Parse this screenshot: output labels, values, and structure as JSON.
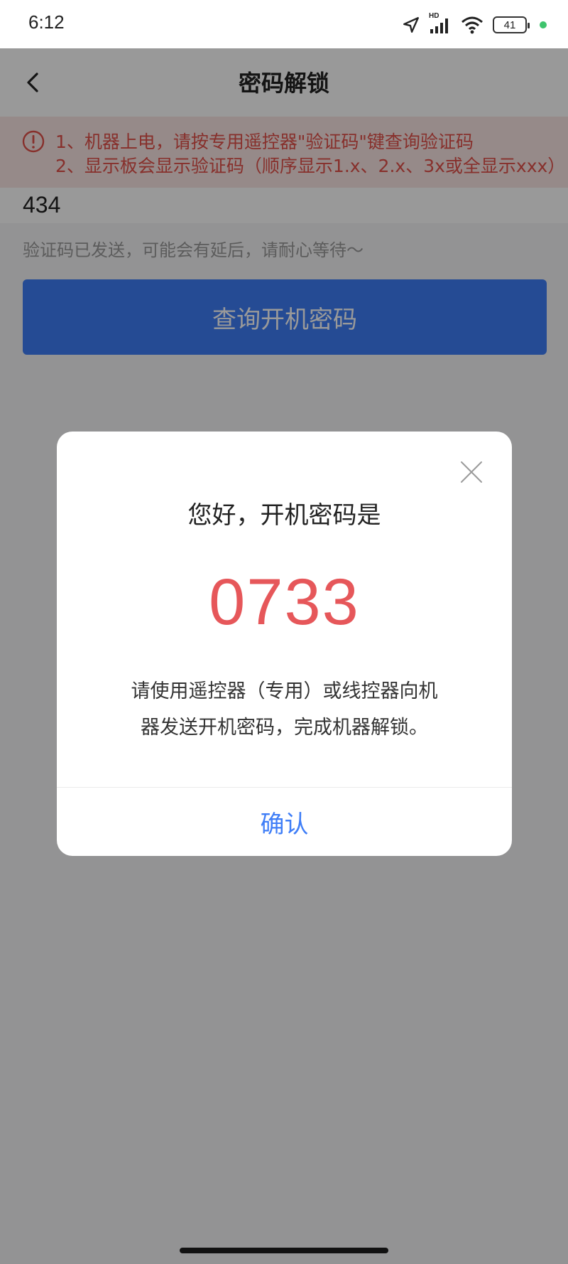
{
  "status_bar": {
    "time": "6:12",
    "network_label": "HD",
    "battery": "41",
    "icons": [
      "location-arrow-icon",
      "signal-icon",
      "wifi-icon",
      "battery-icon"
    ]
  },
  "header": {
    "title": "密码解锁",
    "back_icon": "chevron-left-icon"
  },
  "notice": {
    "icon": "exclamation-circle-icon",
    "line1": "1、机器上电，请按专用遥控器\"验证码\"键查询验证码",
    "line2": "2、显示板会显示验证码（顺序显示1.x、2.x、3x或全显示xxx）"
  },
  "form": {
    "code_value": "434",
    "hint": "验证码已发送，可能会有延后，请耐心等待～",
    "query_button": "查询开机密码"
  },
  "dialog": {
    "title": "您好，开机密码是",
    "code": "0733",
    "desc_line1": "请使用遥控器（专用）或线控器向机",
    "desc_line2": "器发送开机密码，完成机器解锁。",
    "confirm_button": "确认"
  },
  "colors": {
    "accent": "#3f7ef7",
    "code_red": "#e6575a",
    "notice_bg": "#fbe6e4",
    "notice_text": "#e2514a"
  }
}
